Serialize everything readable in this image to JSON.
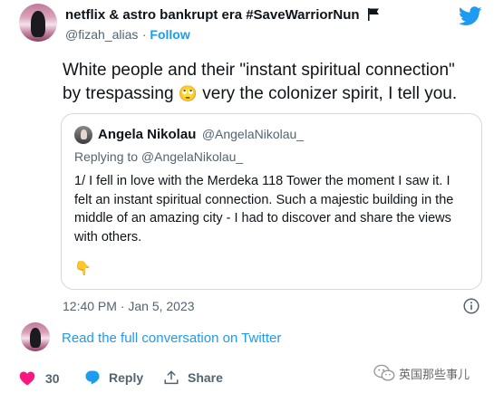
{
  "author": {
    "display_name": "netflix & astro bankrupt era #SaveWarriorNun",
    "handle": "@fizah_alias",
    "follow_label": "Follow"
  },
  "tweet": {
    "text_line1": "White people and their \"instant spiritual connection\"",
    "text_line2_before": "by trespassing",
    "text_line2_emoji": "🙄",
    "text_line2_after": "very the colonizer spirit, I tell you.",
    "timestamp": "12:40 PM · Jan 5, 2023"
  },
  "quoted": {
    "display_name": "Angela Nikolau",
    "handle": "@AngelaNikolau_",
    "replying_to": "Replying to @AngelaNikolau_",
    "lines": [
      "1/ I fell in love with the Merdeka 118 Tower the moment I saw it. I",
      "felt an instant spiritual connection. Such a majestic building in the",
      "middle of an amazing city - I had to discover and share the views",
      "with others."
    ],
    "emoji": "👇"
  },
  "conversation_link": "Read the full conversation on Twitter",
  "actions": {
    "like_count": "30",
    "reply_label": "Reply",
    "share_label": "Share"
  },
  "watermark": "英国那些事儿",
  "colors": {
    "twitter_blue": "#1d9bf0",
    "like_pink": "#f91880",
    "muted": "#536471",
    "border": "#cfd9de"
  },
  "icons": [
    "flag-icon",
    "twitter-bird-icon",
    "info-icon",
    "heart-icon",
    "reply-bubble-icon",
    "share-upload-icon",
    "wechat-icon"
  ]
}
